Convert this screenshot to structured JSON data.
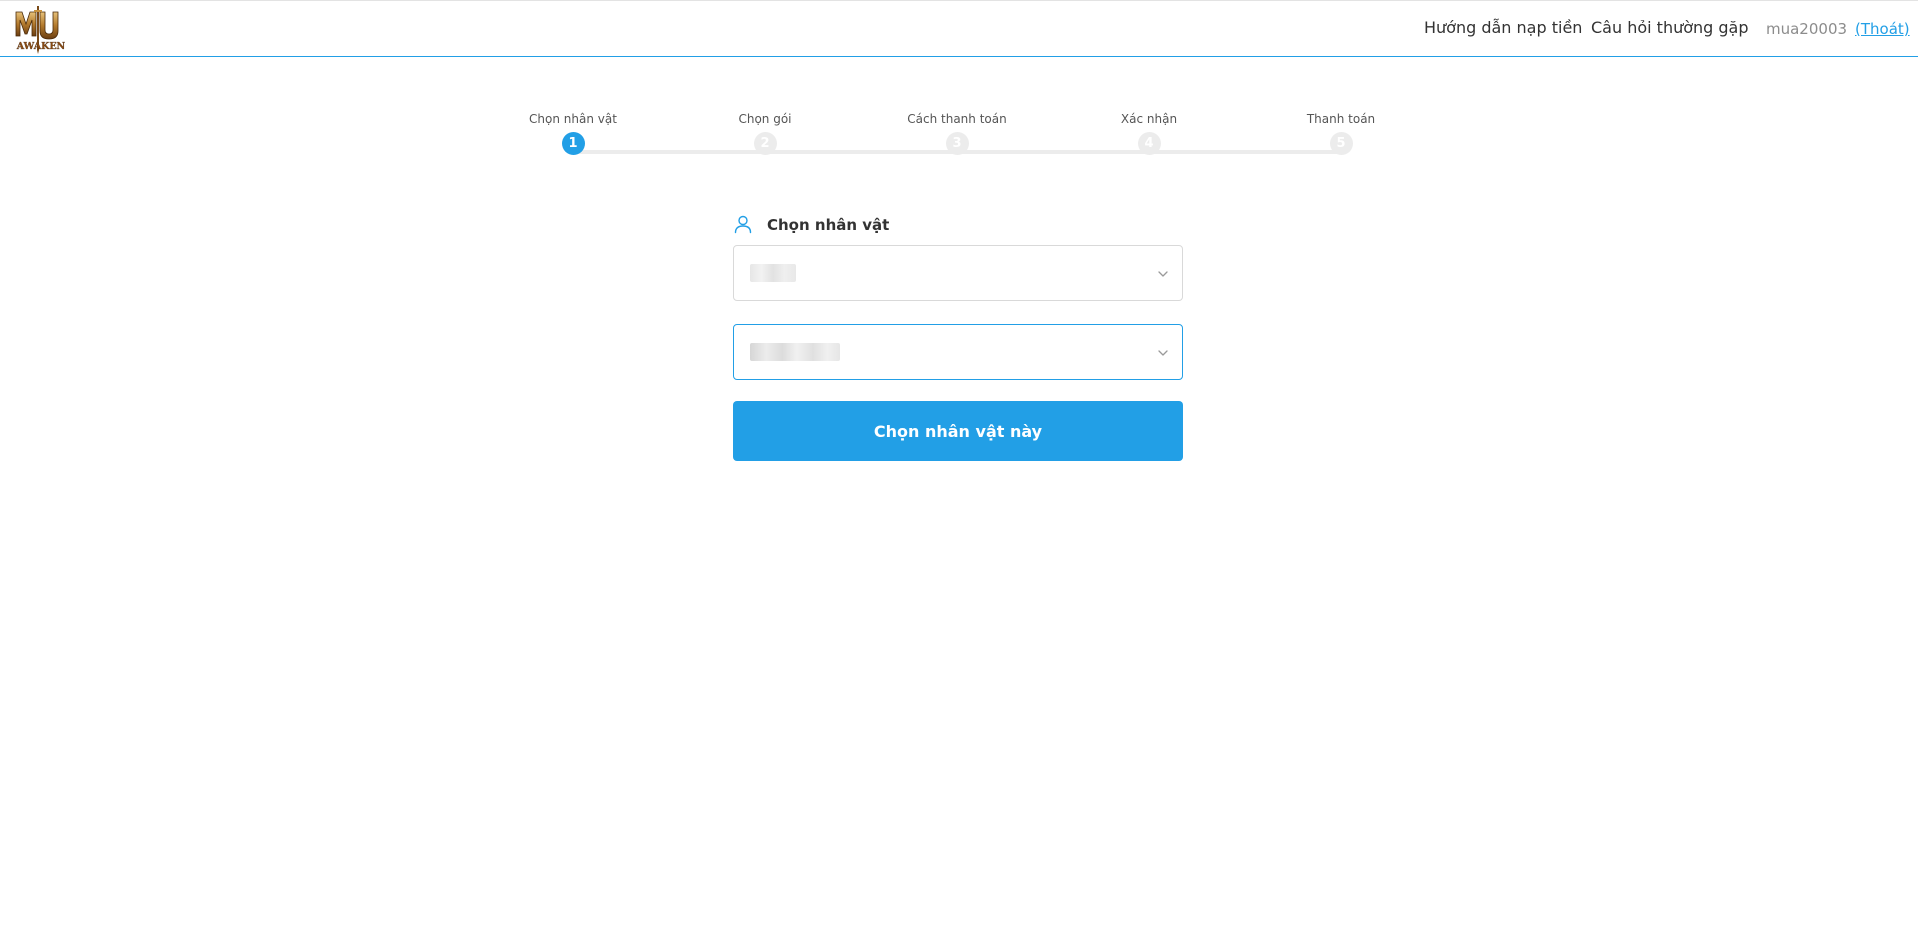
{
  "header": {
    "logo_alt": "MU AWAKEN",
    "nav": [
      {
        "label": "Hướng dẫn nạp tiền"
      },
      {
        "label": "Câu hỏi thường gặp"
      }
    ],
    "username": "mua20003",
    "logout_label": "(Thoát)"
  },
  "stepper": {
    "current_step": 1,
    "steps": [
      {
        "number": "1",
        "label": "Chọn nhân vật"
      },
      {
        "number": "2",
        "label": "Chọn gói"
      },
      {
        "number": "3",
        "label": "Cách thanh toán"
      },
      {
        "number": "4",
        "label": "Xác nhận"
      },
      {
        "number": "5",
        "label": "Thanh toán"
      }
    ]
  },
  "form": {
    "title": "Chọn nhân vật",
    "selects": [
      {
        "value": "",
        "icon": "chevron-down-icon"
      },
      {
        "value": "",
        "icon": "chevron-down-icon"
      }
    ],
    "submit_label": "Chọn nhân vật này"
  },
  "colors": {
    "accent": "#229fe6",
    "track": "#ececec",
    "text": "#333333"
  }
}
